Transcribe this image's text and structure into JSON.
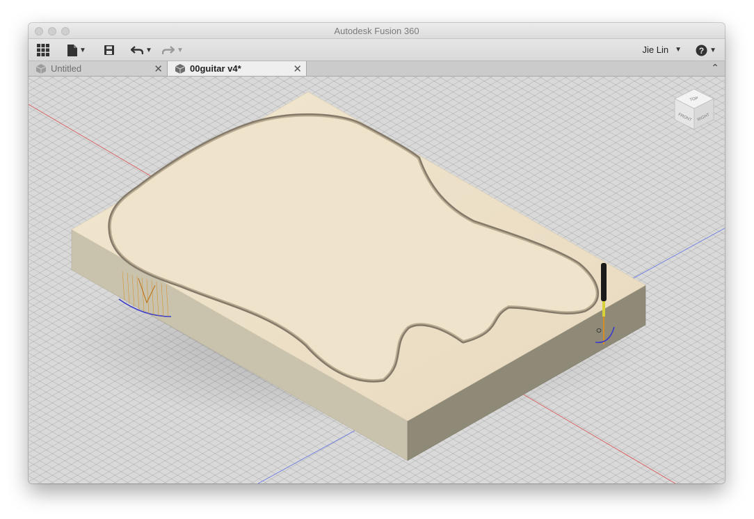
{
  "window": {
    "title": "Autodesk Fusion 360"
  },
  "toolbar": {
    "items": [
      {
        "name": "data-panel",
        "icon": "grid-icon"
      },
      {
        "name": "file-menu",
        "icon": "file-icon"
      },
      {
        "name": "save",
        "icon": "save-icon"
      },
      {
        "name": "undo",
        "icon": "undo-icon"
      },
      {
        "name": "redo",
        "icon": "redo-icon"
      }
    ],
    "user_name": "Jie Lin",
    "help_icon": "help-icon"
  },
  "tabs": [
    {
      "label": "Untitled",
      "active": false
    },
    {
      "label": "00guitar v4*",
      "active": true
    }
  ],
  "viewcube": {
    "top": "TOP",
    "front": "FRONT",
    "right": "RIGHT"
  },
  "colors": {
    "stock_top": "#ede0c6",
    "stock_side_left": "#c9c3ae",
    "stock_side_right": "#8f8a78",
    "axis_red": "#d85a5a",
    "axis_blue": "#6a7be0",
    "tool_black": "#1a1a1a",
    "toolpath_orange": "#d98c1f"
  }
}
